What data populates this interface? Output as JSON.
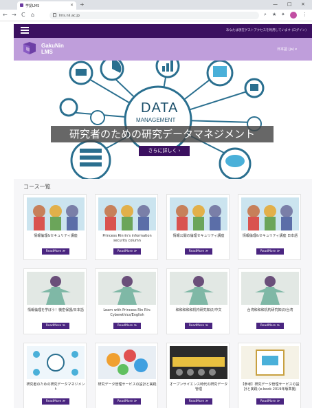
{
  "browser": {
    "tab_title": "学認LMS",
    "tab_close": "×",
    "new_tab": "+",
    "url": "lms.nii.ac.jp",
    "minimize": "—",
    "maximize": "□",
    "close": "×",
    "back": "←",
    "forward": "→",
    "reload": "C",
    "home": "⌂"
  },
  "site": {
    "top_note": "あなたは現在ゲストアクセスを利用しています (ログイン)",
    "logo_line1": "GakuNin",
    "logo_line2": "LMS",
    "language": "日本語 (ja) ▾"
  },
  "hero": {
    "graphic_word1": "DATA",
    "graphic_word2": "MANAGEMENT",
    "title": "研究者のための研究データマネジメント",
    "button": "さらに詳しく ›"
  },
  "courses": {
    "heading": "コース一覧",
    "readmore": "ReadMore ≫",
    "items": [
      {
        "title": "情報倫理&セキュリティ講座"
      },
      {
        "title": "Princess Rinrin's information security column"
      },
      {
        "title": "情報公開の倫理セキュリティ講座"
      },
      {
        "title": "情報倫理&セキュリティ講座 日本語"
      },
      {
        "title": "情報倫理を学ぼう！機密保護/日本語"
      },
      {
        "title": "Learn with Princess Rin Rin: Cyberethics/English"
      },
      {
        "title": "和和和和和机构研究知识/中文"
      },
      {
        "title": "台湾和和和机构研究知识/台湾"
      },
      {
        "title": "研究者のための研究データマネジメント"
      },
      {
        "title": "研究データ管理サービスの設計と実践"
      },
      {
        "title": "オープンサイエンス時代の研究データ管理"
      },
      {
        "title": "【参考】研究データ管理サービスの設計と実践 (e-book 2019年版準拠)"
      }
    ]
  },
  "colors": {
    "nav": "#3b1060",
    "brand": "#bf9edb",
    "button": "#4a2580"
  }
}
